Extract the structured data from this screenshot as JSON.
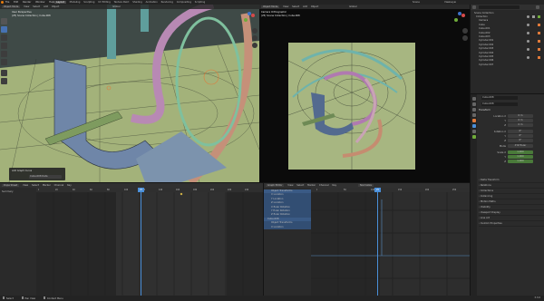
{
  "topbar": {
    "menus": [
      "File",
      "Edit",
      "Render",
      "Window",
      "Help"
    ],
    "workspace_tabs": [
      "Layout",
      "Modeling",
      "Sculpting",
      "UV Editing",
      "Texture Paint",
      "Shading",
      "Animation",
      "Rendering",
      "Compositing",
      "Scripting"
    ],
    "active_tab": "Layout",
    "scene_label": "Scene",
    "view_layer_label": "ViewLayer"
  },
  "left_viewport": {
    "mode": "Object Mode",
    "menus": [
      "View",
      "Select",
      "Add",
      "Object"
    ],
    "overlay_title": "User Perspective",
    "overlay_subtitle": "(25) Scene Collection | Cube.008",
    "transform_label": "Global",
    "operator_panel_title": "Add Graph Curve",
    "operator_row_label": "Cube.008 Data",
    "tool_icons": [
      "cursor-icon",
      "select-box-icon",
      "move-icon",
      "rotate-icon",
      "scale-icon",
      "transform-icon",
      "annotate-icon",
      "measure-icon"
    ]
  },
  "camera_viewport": {
    "mode": "Object Mode",
    "menus": [
      "View",
      "Select",
      "Add",
      "Object"
    ],
    "overlay_title": "Camera Orthographic",
    "overlay_subtitle": "(25) Scene Collection | Cube.008",
    "transform_label": "Global"
  },
  "outliner": {
    "title": "Scene Collection",
    "items": [
      "Collection",
      "Camera",
      "Cube",
      "Cube.001",
      "Cube.002",
      "Cube.003",
      "Cylinder.001",
      "Cylinder.002",
      "Cylinder.003",
      "Cylinder.004",
      "Cylinder.005",
      "Cylinder.006",
      "Cylinder.007"
    ]
  },
  "properties": {
    "object_name": "Cube.008",
    "section_transform": "Transform",
    "fields": [
      {
        "label": "Location X",
        "value": "0 m"
      },
      {
        "label": "Y",
        "value": "0 m"
      },
      {
        "label": "Z",
        "value": "0 m"
      },
      {
        "label": "Rotation X",
        "value": "0°"
      },
      {
        "label": "Y",
        "value": "0°"
      },
      {
        "label": "Z",
        "value": "0°"
      },
      {
        "label": "Mode",
        "value": "XYZ Euler"
      },
      {
        "label": "Scale X",
        "value": "1.000"
      },
      {
        "label": "Y",
        "value": "1.000"
      },
      {
        "label": "Z",
        "value": "1.000"
      }
    ],
    "sections": [
      "Delta Transform",
      "Relations",
      "Collections",
      "Instancing",
      "Motion Paths",
      "Visibility",
      "Viewport Display",
      "Line Art",
      "Custom Properties"
    ]
  },
  "dopesheet": {
    "menus": [
      "View",
      "Select",
      "Marker",
      "Channel",
      "Key"
    ],
    "mode": "Dope Sheet",
    "summary_label": "Summary",
    "frame_ticks": [
      "0",
      "20",
      "40",
      "60",
      "80",
      "100",
      "120",
      "140",
      "160",
      "180",
      "200",
      "220",
      "240"
    ],
    "current_frame": "25"
  },
  "graph_editor": {
    "menus": [
      "View",
      "Select",
      "Marker",
      "Channel",
      "Key"
    ],
    "mode": "Graph Editor",
    "filter_label": "Normalize",
    "channels": [
      "Object Transforms",
      "X Location",
      "Y Location",
      "Z Location",
      "X Euler Rotation",
      "Y Euler Rotation",
      "Z Euler Rotation",
      "Cube.008",
      "Object Transforms",
      "X Location"
    ],
    "frame_ticks": [
      "0",
      "50",
      "100",
      "150",
      "200",
      "250"
    ],
    "current_frame": "25"
  },
  "statusbar": {
    "left": "Select",
    "middle": "Pan View",
    "right": "Context Menu",
    "version": "3.3.0"
  }
}
